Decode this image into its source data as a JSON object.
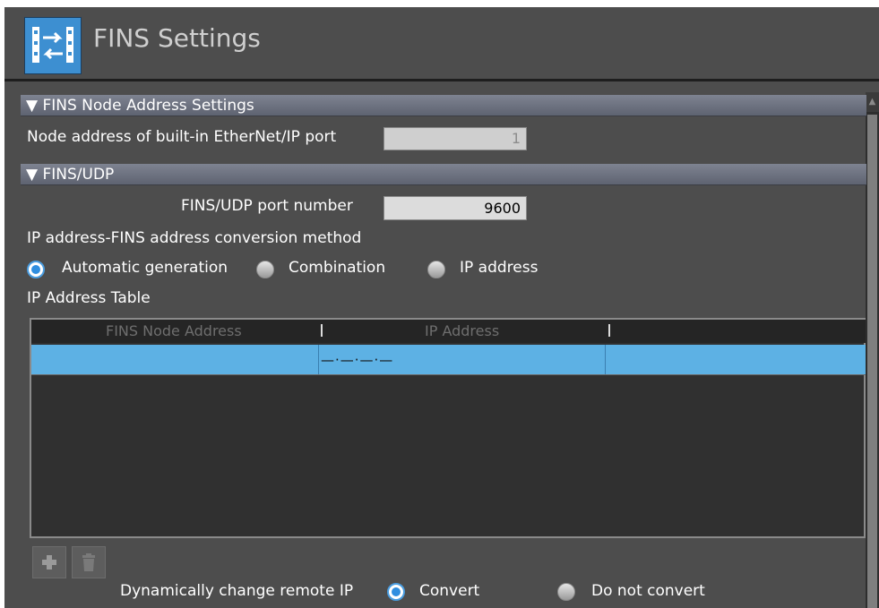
{
  "window": {
    "title": "FINS Settings",
    "icon": "fins-settings-icon"
  },
  "sections": {
    "node_address": {
      "header": "▼ FINS Node Address Settings",
      "label": "Node address of built-in EtherNet/IP port",
      "value": "1"
    },
    "fins_udp": {
      "header": "▼ FINS/UDP",
      "port_label": "FINS/UDP port number",
      "port_value": "9600",
      "conversion_label": "IP address-FINS address conversion method",
      "conversion_options": [
        {
          "label": "Automatic generation",
          "selected": true
        },
        {
          "label": "Combination",
          "selected": false
        },
        {
          "label": "IP address",
          "selected": false
        }
      ],
      "table_label": "IP Address Table",
      "table": {
        "columns": [
          "FINS Node Address",
          "IP Address"
        ],
        "rows": [
          {
            "node": "",
            "ip": "—·—·—·—"
          }
        ]
      },
      "dynamic_label": "Dynamically change remote IP",
      "dynamic_options": [
        {
          "label": "Convert",
          "selected": true
        },
        {
          "label": "Do not convert",
          "selected": false
        }
      ]
    }
  },
  "colors": {
    "panel": "#4d4d4d",
    "header": "#6a6f7c",
    "accent": "#3d8fd1",
    "row_selected": "#5db1e4"
  }
}
